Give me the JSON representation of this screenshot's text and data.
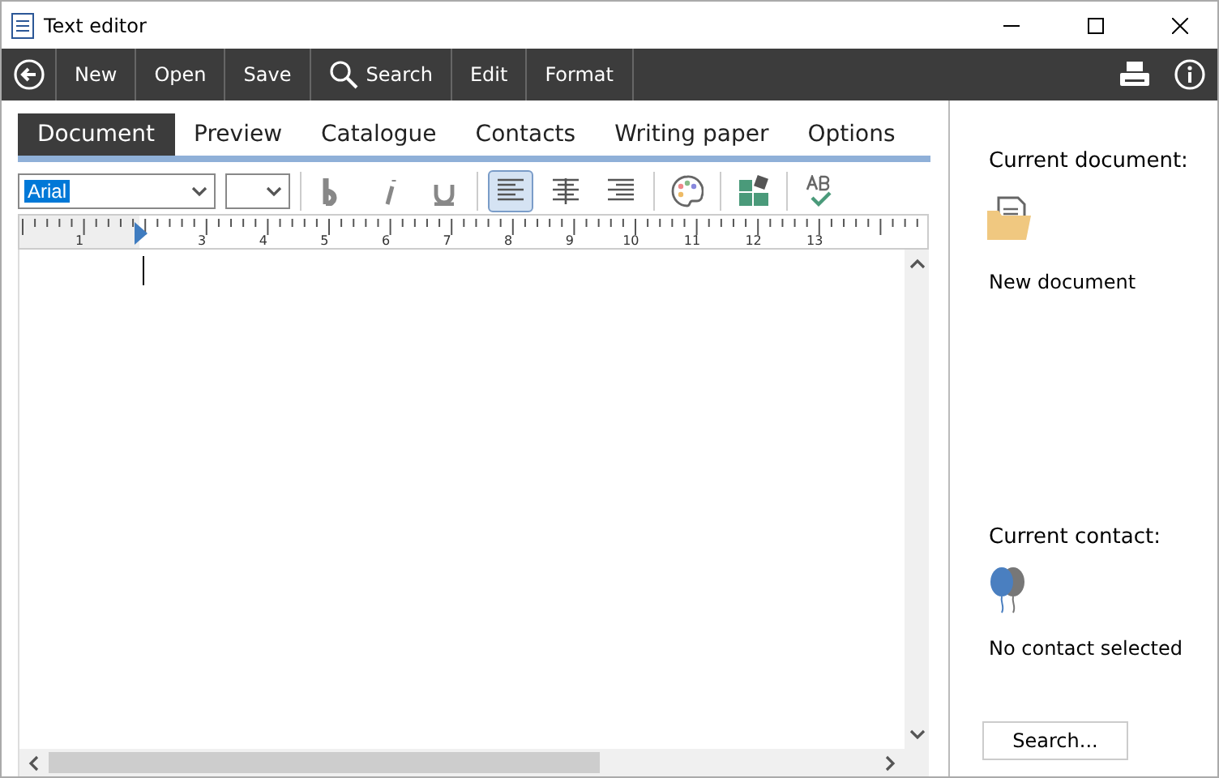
{
  "window": {
    "title": "Text editor"
  },
  "toolbar": {
    "items": [
      {
        "label": "New",
        "kind": "text"
      },
      {
        "label": "Open",
        "kind": "text"
      },
      {
        "label": "Save",
        "kind": "text"
      },
      {
        "label": "Search",
        "kind": "search"
      },
      {
        "label": "Edit",
        "kind": "text"
      },
      {
        "label": "Format",
        "kind": "text"
      }
    ]
  },
  "tabs": [
    {
      "label": "Document",
      "selected": true
    },
    {
      "label": "Preview",
      "selected": false
    },
    {
      "label": "Catalogue",
      "selected": false
    },
    {
      "label": "Contacts",
      "selected": false
    },
    {
      "label": "Writing paper",
      "selected": false
    },
    {
      "label": "Options",
      "selected": false
    }
  ],
  "format_bar": {
    "font": "Arial",
    "align_left": true
  },
  "ruler": {
    "labels_before_marker": [
      "1"
    ],
    "labels_after_marker": [
      "3",
      "4",
      "5",
      "6",
      "7",
      "8",
      "9",
      "10",
      "11",
      "12",
      "13"
    ]
  },
  "side_panel": {
    "document_heading": "Current document:",
    "document_name": "New document",
    "contact_heading": "Current contact:",
    "contact_name": "No contact selected",
    "search_button": "Search..."
  }
}
